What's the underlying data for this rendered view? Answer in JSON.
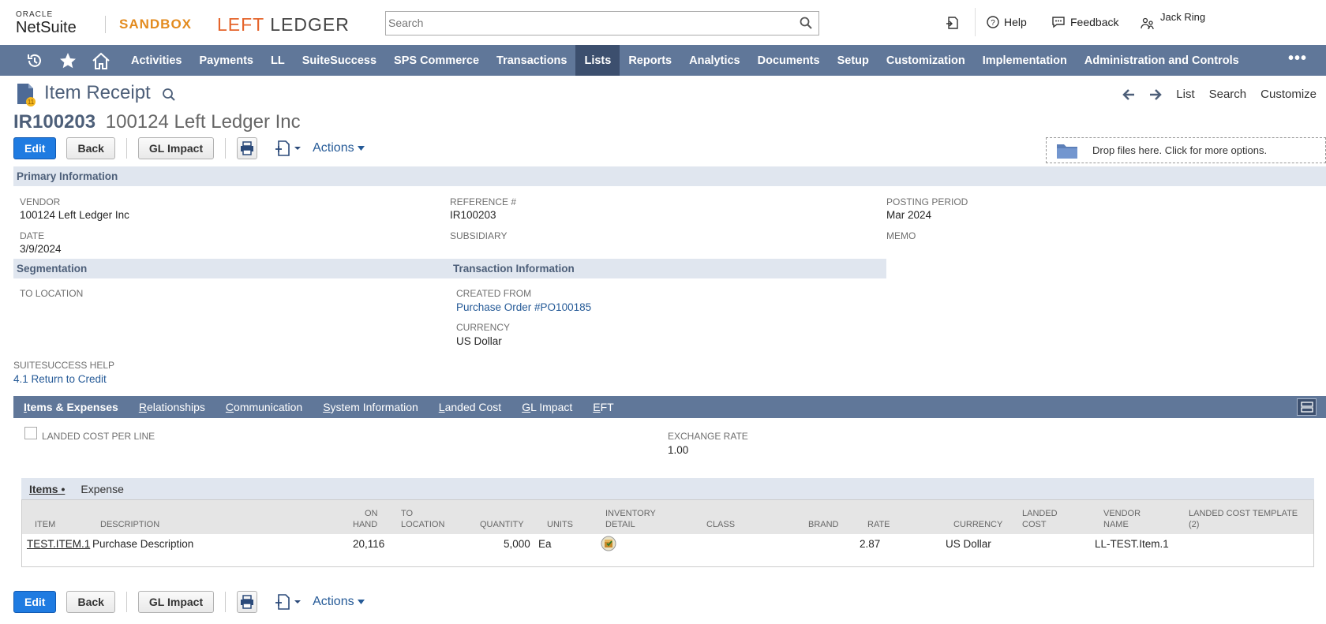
{
  "header": {
    "oracle": "ORACLE",
    "netsuite": "NetSuite",
    "sandbox": "SANDBOX",
    "logo_left": "LEFT",
    "logo_ledger": "LEDGER",
    "search_placeholder": "Search",
    "help": "Help",
    "feedback": "Feedback",
    "user": "Jack Ring"
  },
  "nav": {
    "items": [
      "Activities",
      "Payments",
      "LL",
      "SuiteSuccess",
      "SPS Commerce",
      "Transactions",
      "Lists",
      "Reports",
      "Analytics",
      "Documents",
      "Setup",
      "Customization",
      "Implementation",
      "Administration and Controls"
    ],
    "active": "Lists",
    "more": "•••"
  },
  "page": {
    "title": "Item Receipt",
    "links": {
      "list": "List",
      "search": "Search",
      "customize": "Customize"
    },
    "record_number": "IR100203",
    "record_name": "100124 Left Ledger Inc"
  },
  "buttons": {
    "edit": "Edit",
    "back": "Back",
    "gl_impact": "GL Impact",
    "actions": "Actions"
  },
  "dropzone": "Drop files here. Click for more options.",
  "primary": {
    "header": "Primary Information",
    "vendor_label": "VENDOR",
    "vendor_value": "100124 Left Ledger Inc",
    "reference_label": "REFERENCE #",
    "reference_value": "IR100203",
    "posting_label": "POSTING PERIOD",
    "posting_value": "Mar 2024",
    "date_label": "DATE",
    "date_value": "3/9/2024",
    "subsidiary_label": "SUBSIDIARY",
    "memo_label": "MEMO"
  },
  "segmentation": {
    "header": "Segmentation",
    "to_location_label": "TO LOCATION"
  },
  "transaction": {
    "header": "Transaction Information",
    "created_from_label": "CREATED FROM",
    "created_from_value": "Purchase Order #PO100185",
    "currency_label": "CURRENCY",
    "currency_value": "US Dollar"
  },
  "suitesuccess": {
    "label": "SUITESUCCESS HELP",
    "value": "4.1 Return to Credit"
  },
  "tabs": [
    {
      "u": "I",
      "rest": "tems & Expenses"
    },
    {
      "u": "R",
      "rest": "elationships"
    },
    {
      "u": "C",
      "rest": "ommunication"
    },
    {
      "u": "S",
      "rest": "ystem Information"
    },
    {
      "u": "L",
      "rest": "anded Cost"
    },
    {
      "u": "G",
      "rest": "L Impact"
    },
    {
      "u": "E",
      "rest": "FT"
    }
  ],
  "items_section": {
    "landed_cost_label": "LANDED COST PER LINE",
    "exchange_rate_label": "EXCHANGE RATE",
    "exchange_rate_value": "1.00",
    "subtab_items": "Items •",
    "subtab_expense": "Expense"
  },
  "table": {
    "columns": {
      "item": "ITEM",
      "description": "DESCRIPTION",
      "on_hand_1": "ON",
      "on_hand_2": "HAND",
      "to_location_1": "TO",
      "to_location_2": "LOCATION",
      "quantity": "QUANTITY",
      "units": "UNITS",
      "inventory_1": "INVENTORY",
      "inventory_2": "DETAIL",
      "class": "CLASS",
      "brand": "BRAND",
      "rate": "RATE",
      "currency": "CURRENCY",
      "landed_1": "LANDED",
      "landed_2": "COST",
      "vendor_1": "VENDOR",
      "vendor_2": "NAME",
      "template_1": "LANDED COST TEMPLATE",
      "template_2": "(2)"
    },
    "row": {
      "item": "TEST.ITEM.1",
      "description": "Purchase Description",
      "on_hand": "20,116",
      "quantity": "5,000",
      "units": "Ea",
      "rate": "2.87",
      "currency": "US Dollar",
      "vendor_name": "LL-TEST.Item.1"
    }
  },
  "colors": {
    "nav": "#607799",
    "nav_active": "#3c4f6e",
    "primary_button": "#1f7be1",
    "section": "#e0e6ef",
    "link": "#255a97"
  }
}
